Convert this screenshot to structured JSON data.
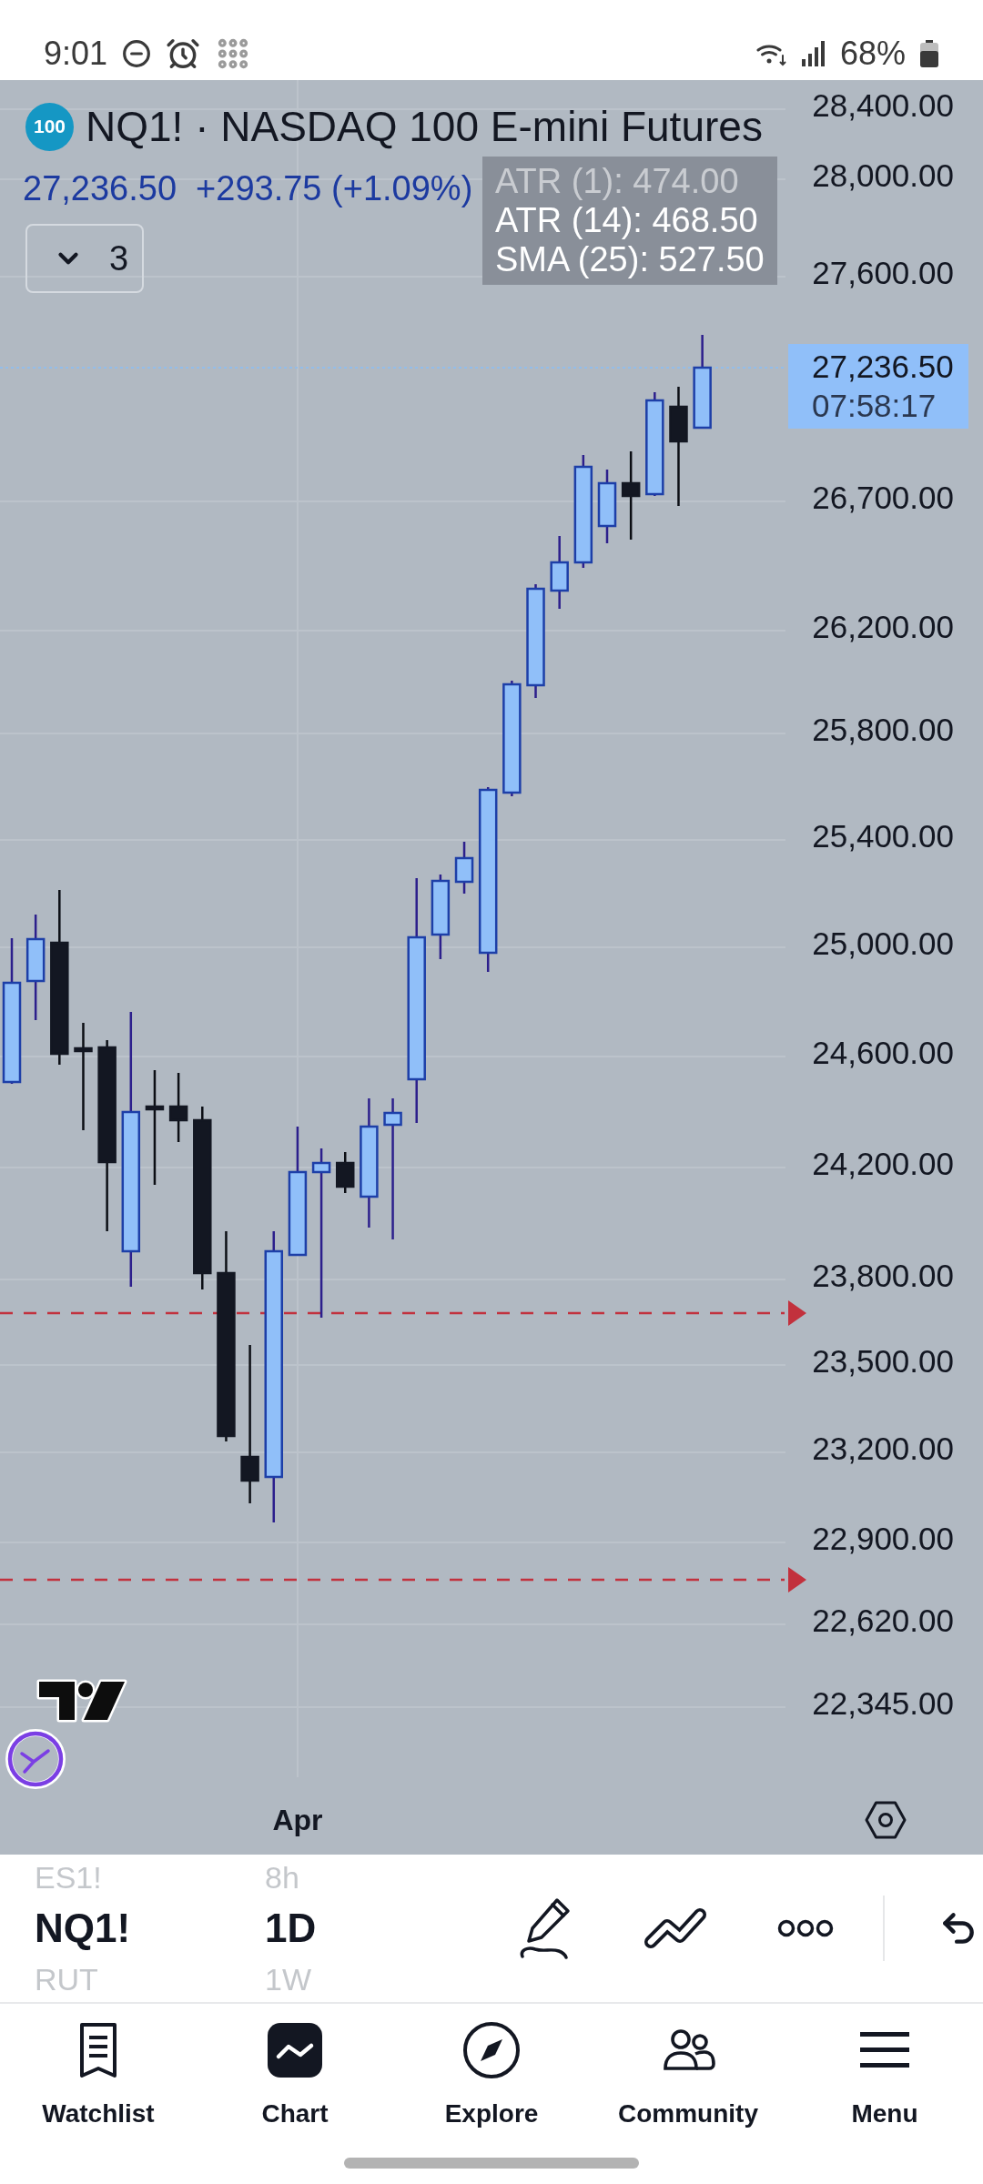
{
  "status_bar": {
    "time": "9:01",
    "battery": "68%"
  },
  "symbol": {
    "logo": "100",
    "title": "NQ1! · NASDAQ 100 E-mini Futures",
    "price": "27,236.50",
    "change": "+293.75 (+1.09%)"
  },
  "indicator_toggle": {
    "count": "3",
    "expanded": false
  },
  "indicators": [
    {
      "label": "ATR (1): 474.00",
      "dimmed": true
    },
    {
      "label": "ATR (14): 468.50",
      "dimmed": false
    },
    {
      "label": "SMA (25): 527.50",
      "dimmed": false
    }
  ],
  "price_axis": {
    "labels": [
      "28,400.00",
      "28,000.00",
      "27,600.00",
      "26,700.00",
      "26,200.00",
      "25,800.00",
      "25,400.00",
      "25,000.00",
      "24,600.00",
      "24,200.00",
      "23,800.00",
      "23,500.00",
      "23,200.00",
      "22,900.00",
      "22,620.00",
      "22,345.00"
    ],
    "last_price": "27,236.50",
    "countdown": "07:58:17"
  },
  "time_axis": {
    "labels": [
      "Apr"
    ]
  },
  "symbol_picker": [
    {
      "label": "ES1!",
      "selected": false
    },
    {
      "label": "NQ1!",
      "selected": true
    },
    {
      "label": "RUT",
      "selected": false
    }
  ],
  "interval_picker": [
    {
      "label": "8h",
      "selected": false
    },
    {
      "label": "1D",
      "selected": true
    },
    {
      "label": "1W",
      "selected": false
    }
  ],
  "bottom_nav": [
    {
      "label": "Watchlist",
      "selected": false
    },
    {
      "label": "Chart",
      "selected": true
    },
    {
      "label": "Explore",
      "selected": false
    },
    {
      "label": "Community",
      "selected": false
    },
    {
      "label": "Menu",
      "selected": false
    }
  ]
}
